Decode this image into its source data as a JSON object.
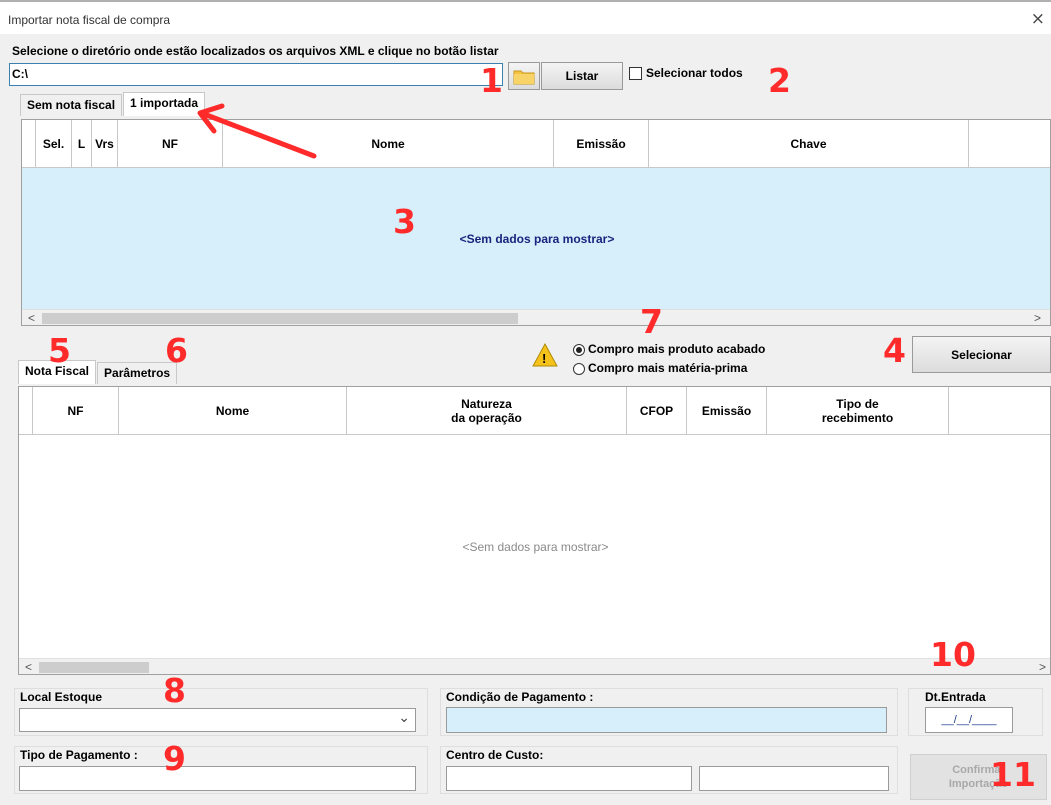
{
  "window": {
    "title": "Importar nota fiscal de compra",
    "close_icon": "×"
  },
  "instruction": "Selecione o diretório onde estão localizados os arquivos XML e clique no botão listar",
  "path_input": {
    "value": "C:\\"
  },
  "folder_icon": "folder-icon",
  "list_button": "Listar",
  "select_all": {
    "label": "Selecionar todos",
    "checked": false
  },
  "top_tabs": [
    "Sem nota fiscal",
    "1 importada"
  ],
  "top_grid": {
    "columns": [
      "Sel.",
      "L",
      "Vrs",
      "NF",
      "Nome",
      "Emissão",
      "Chave",
      ""
    ],
    "empty_text": "<Sem dados para mostrar>"
  },
  "scroll_left": "<",
  "scroll_right": ">",
  "bottom_tabs": [
    "Nota Fiscal",
    "Parâmetros"
  ],
  "warning_icon": "warning-icon",
  "warning_symbol": "!",
  "radio_options": [
    {
      "label": "Compro mais produto acabado",
      "selected": true
    },
    {
      "label": "Compro mais matéria-prima",
      "selected": false
    }
  ],
  "select_button": "Selecionar",
  "bottom_grid": {
    "columns": [
      "",
      "NF",
      "Nome",
      "Natureza\nda operação",
      "CFOP",
      "Emissão",
      "Tipo de\nrecebimento",
      ""
    ],
    "empty_text": "<Sem dados para mostrar>"
  },
  "form": {
    "local_estoque_label": "Local Estoque",
    "dropdown_arrow": "⌄",
    "condicao_label": "Condição de Pagamento :",
    "dt_entrada_label": "Dt.Entrada",
    "dt_entrada_value": "__/__/____",
    "tipo_pagamento_label": "Tipo de Pagamento :",
    "centro_custo_label": "Centro de Custo:",
    "confirm_button_line1": "Confirmar",
    "confirm_button_line2": "Importação"
  },
  "annotations": [
    "1",
    "2",
    "3",
    "4",
    "5",
    "6",
    "7",
    "8",
    "9",
    "10",
    "11"
  ],
  "colors": {
    "annotation": "#ff2b2b",
    "grid_empty_bg": "#d6effa",
    "empty_text_top": "#1a237e",
    "empty_text_bottom": "#8a8a8a",
    "input_highlight": "#d6effa",
    "warning_icon": "#f4c21b"
  }
}
